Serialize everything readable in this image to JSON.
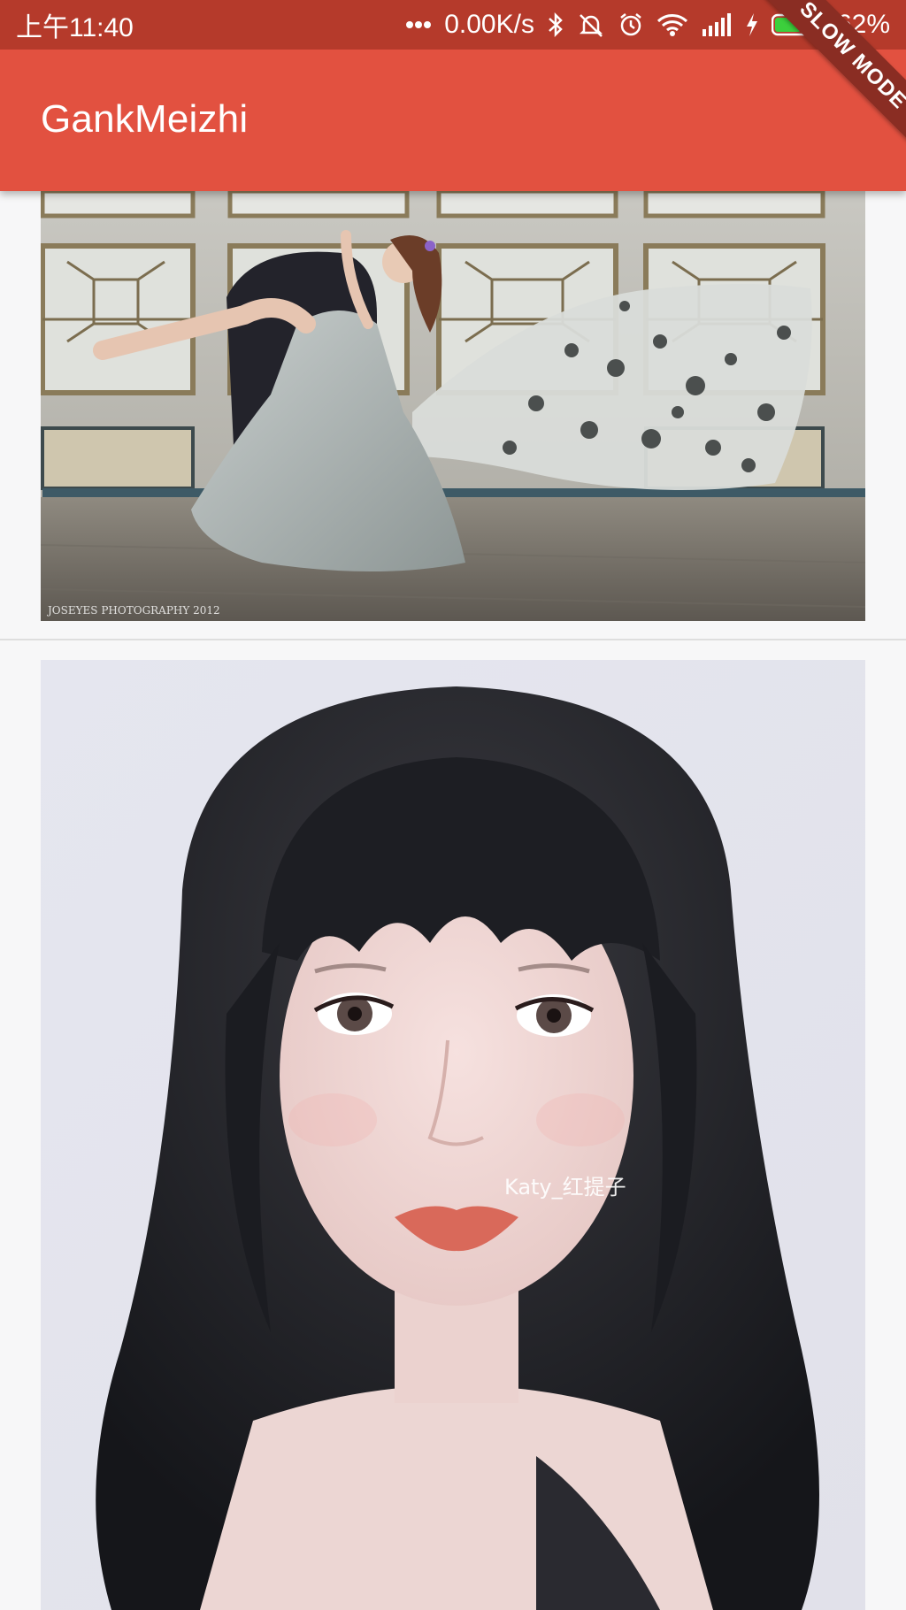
{
  "status_bar": {
    "time": "上午11:40",
    "network_speed": "0.00K/s",
    "battery_percent": "62%",
    "battery_level": 0.62,
    "icons": [
      "more-dots-icon",
      "bluetooth-icon",
      "mute-icon",
      "alarm-icon",
      "wifi-icon",
      "signal-icon",
      "charging-icon",
      "battery-icon"
    ]
  },
  "debug_banner": {
    "label": "SLOW MODE"
  },
  "app_bar": {
    "title": "GankMeizhi"
  },
  "feed": {
    "items": [
      {
        "type": "photo",
        "description_icon": "bride-photo",
        "watermark": "JOSEYES PHOTOGRAPHY 2012"
      },
      {
        "type": "photo",
        "description_icon": "portrait-photo",
        "watermark": "Katy_红提子"
      }
    ]
  },
  "colors": {
    "status_bar": "#b53a2b",
    "app_bar": "#e25140",
    "background": "#f7f7f8",
    "divider": "#dedede"
  }
}
